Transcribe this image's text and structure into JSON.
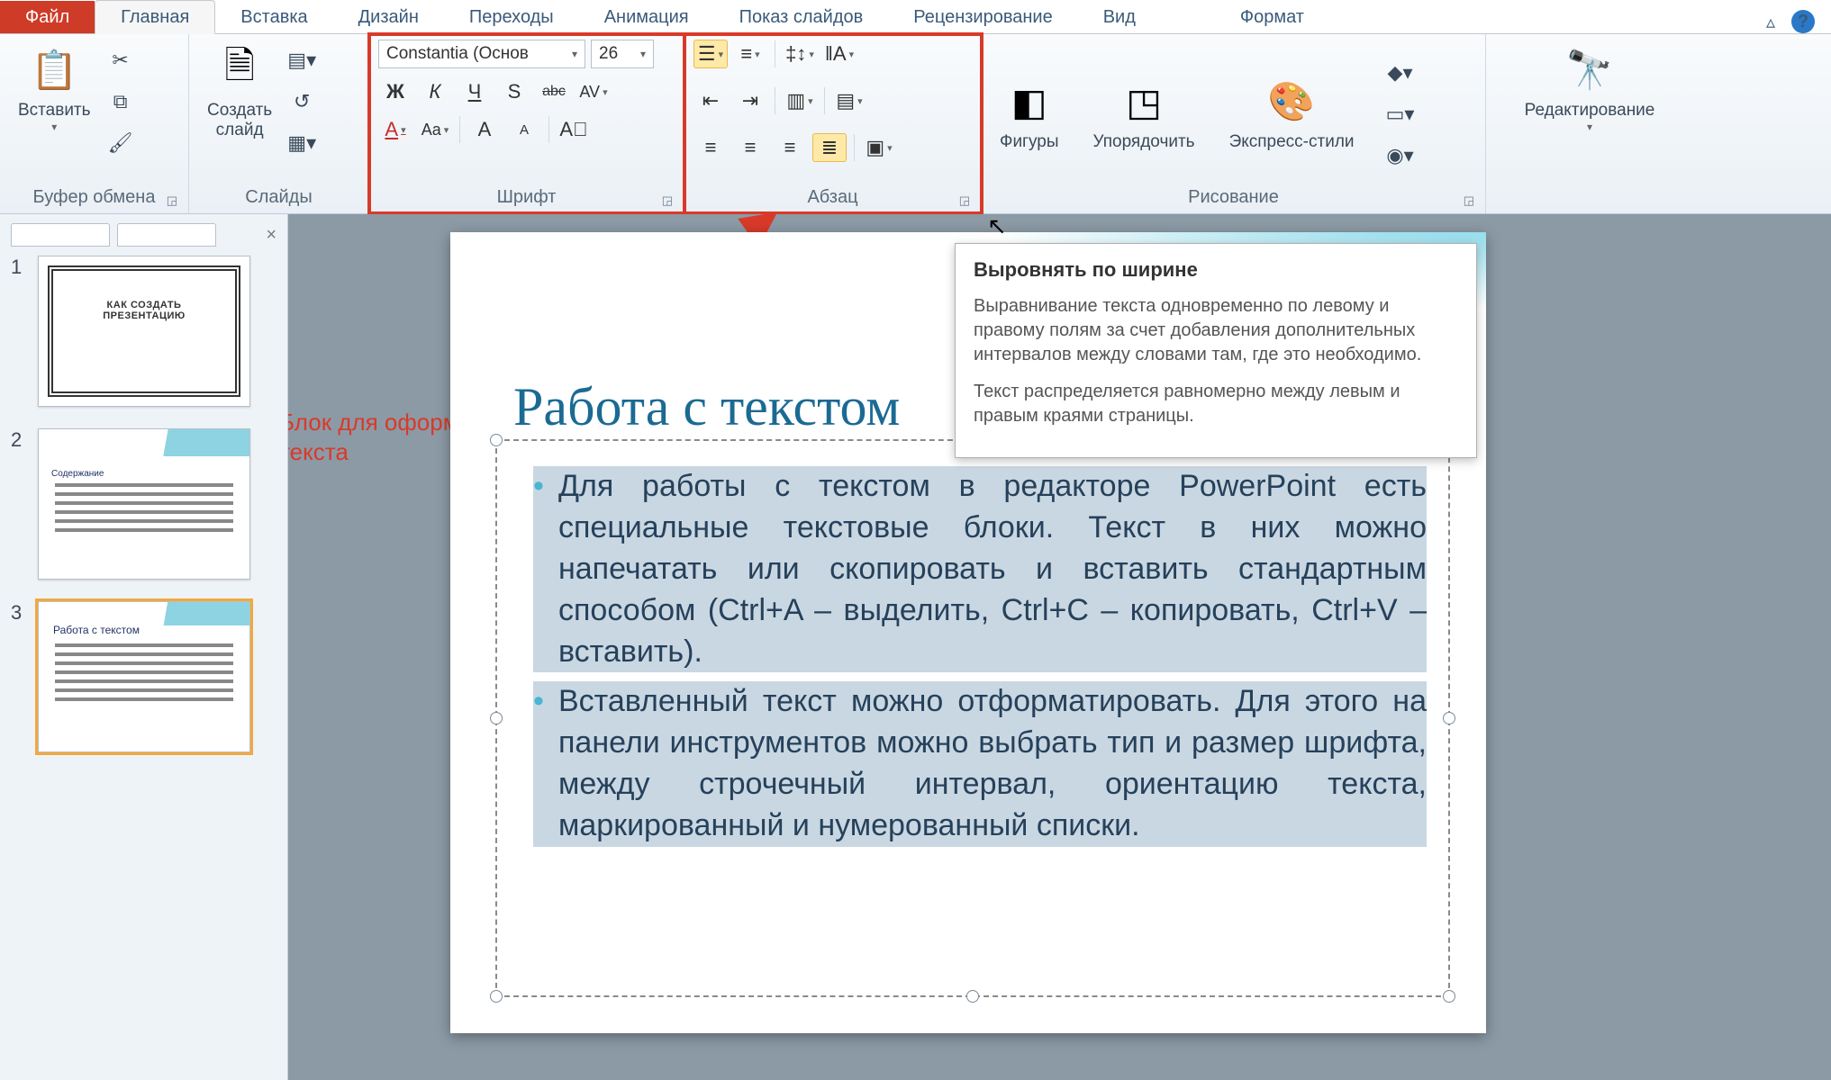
{
  "tabs": {
    "file": "Файл",
    "home": "Главная",
    "insert": "Вставка",
    "design": "Дизайн",
    "transitions": "Переходы",
    "animation": "Анимация",
    "slideshow": "Показ слайдов",
    "review": "Рецензирование",
    "view": "Вид",
    "format": "Формат"
  },
  "ribbon": {
    "clipboard": {
      "label": "Буфер обмена",
      "paste": "Вставить"
    },
    "slides": {
      "label": "Слайды",
      "new": "Создать\nслайд"
    },
    "font": {
      "label": "Шрифт",
      "family": "Constantia (Основ",
      "size": "26",
      "icons": {
        "bold": "Ж",
        "italic": "К",
        "underline": "Ч",
        "shadow": "S",
        "strike": "abc",
        "spacing": "AV",
        "fontcolor": "A",
        "case": "Aa",
        "grow": "A",
        "shrink": "A",
        "clear": "✎"
      }
    },
    "paragraph": {
      "label": "Абзац"
    },
    "drawing": {
      "label": "Рисование",
      "shapes": "Фигуры",
      "arrange": "Упорядочить",
      "styles": "Экспресс-стили"
    },
    "editing": {
      "label": "Редактирование"
    }
  },
  "annotation": "Блок для оформления\nтекста",
  "tooltip": {
    "title": "Выровнять по ширине",
    "p1": "Выравнивание текста одновременно по левому и правому полям за счет добавления дополнительных интервалов между словами там, где это необходимо.",
    "p2": "Текст распределяется равномерно между левым и правым краями страницы."
  },
  "slide": {
    "title": "Работа с текстом",
    "bullets": [
      "Для работы с текстом в редакторе PowerPoint есть специальные текстовые блоки. Текст в них можно напечатать или скопировать и вставить стандартным способом (Ctrl+A – выделить, Ctrl+C – копировать, Ctrl+V – вставить).",
      "Вставленный текст можно отформатировать. Для этого на панели инструментов можно выбрать тип и размер шрифта, между строчечный интервал, ориентацию текста, маркированный и нумерованный списки."
    ]
  },
  "thumbs": {
    "t1": {
      "line1": "КАК СОЗДАТЬ",
      "line2": "ПРЕЗЕНТАЦИЮ"
    },
    "t2_label": "Содержание",
    "t3_title": "Работа с текстом"
  }
}
